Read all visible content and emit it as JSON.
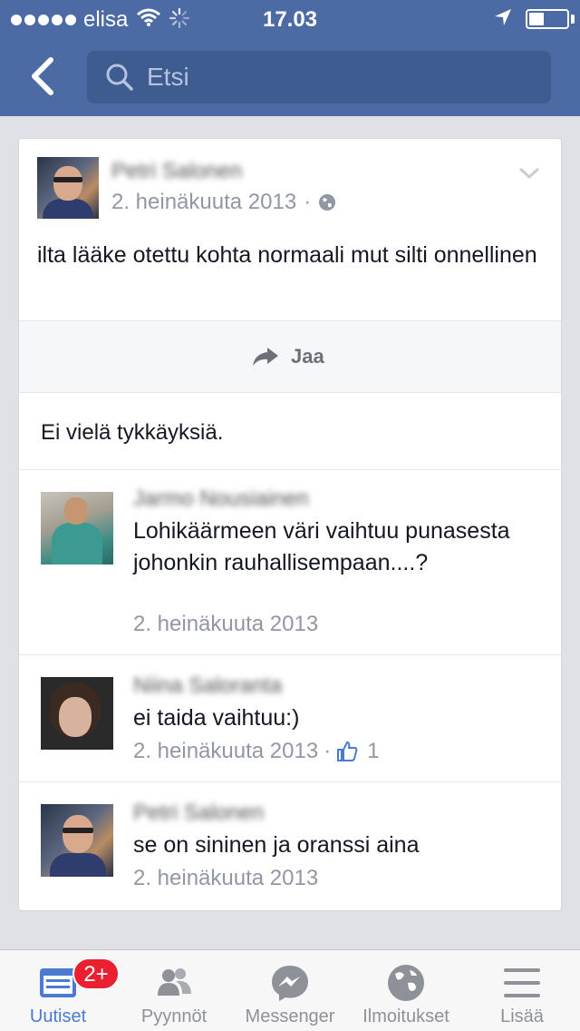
{
  "status_bar": {
    "carrier": "elisa",
    "time": "17.03"
  },
  "nav": {
    "search_placeholder": "Etsi"
  },
  "post": {
    "author": "Petri Salonen",
    "date": "2. heinäkuuta 2013",
    "privacy_separator": "·",
    "text": "ilta lääke otettu kohta normaali mut silti onnellinen",
    "share_label": "Jaa",
    "likes_text": "Ei vielä tykkäyksiä."
  },
  "comments": [
    {
      "author": "Jarmo Nousiainen",
      "text": "Lohikäärmeen väri vaihtuu punasesta johonkin rauhallisempaan....?",
      "date": "2. heinäkuuta 2013"
    },
    {
      "author": "Niina Saloranta",
      "text": "ei taida vaihtuu:)",
      "date": "2. heinäkuuta 2013",
      "separator": "·",
      "like_count": "1"
    },
    {
      "author": "Petri Salonen",
      "text": "se on sininen ja oranssi aina",
      "date": "2. heinäkuuta 2013"
    }
  ],
  "tabbar": {
    "tabs": [
      {
        "label": "Uutiset",
        "icon": "news-feed-icon",
        "active": true,
        "badge": "2+"
      },
      {
        "label": "Pyynnöt",
        "icon": "friend-requests-icon"
      },
      {
        "label": "Messenger",
        "icon": "messenger-icon"
      },
      {
        "label": "Ilmoitukset",
        "icon": "globe-icon"
      },
      {
        "label": "Lisää",
        "icon": "menu-icon"
      }
    ]
  },
  "colors": {
    "header_blue": "#4c6aa4",
    "active_tab": "#4b7bd0",
    "badge_red": "#ea1f2f"
  }
}
